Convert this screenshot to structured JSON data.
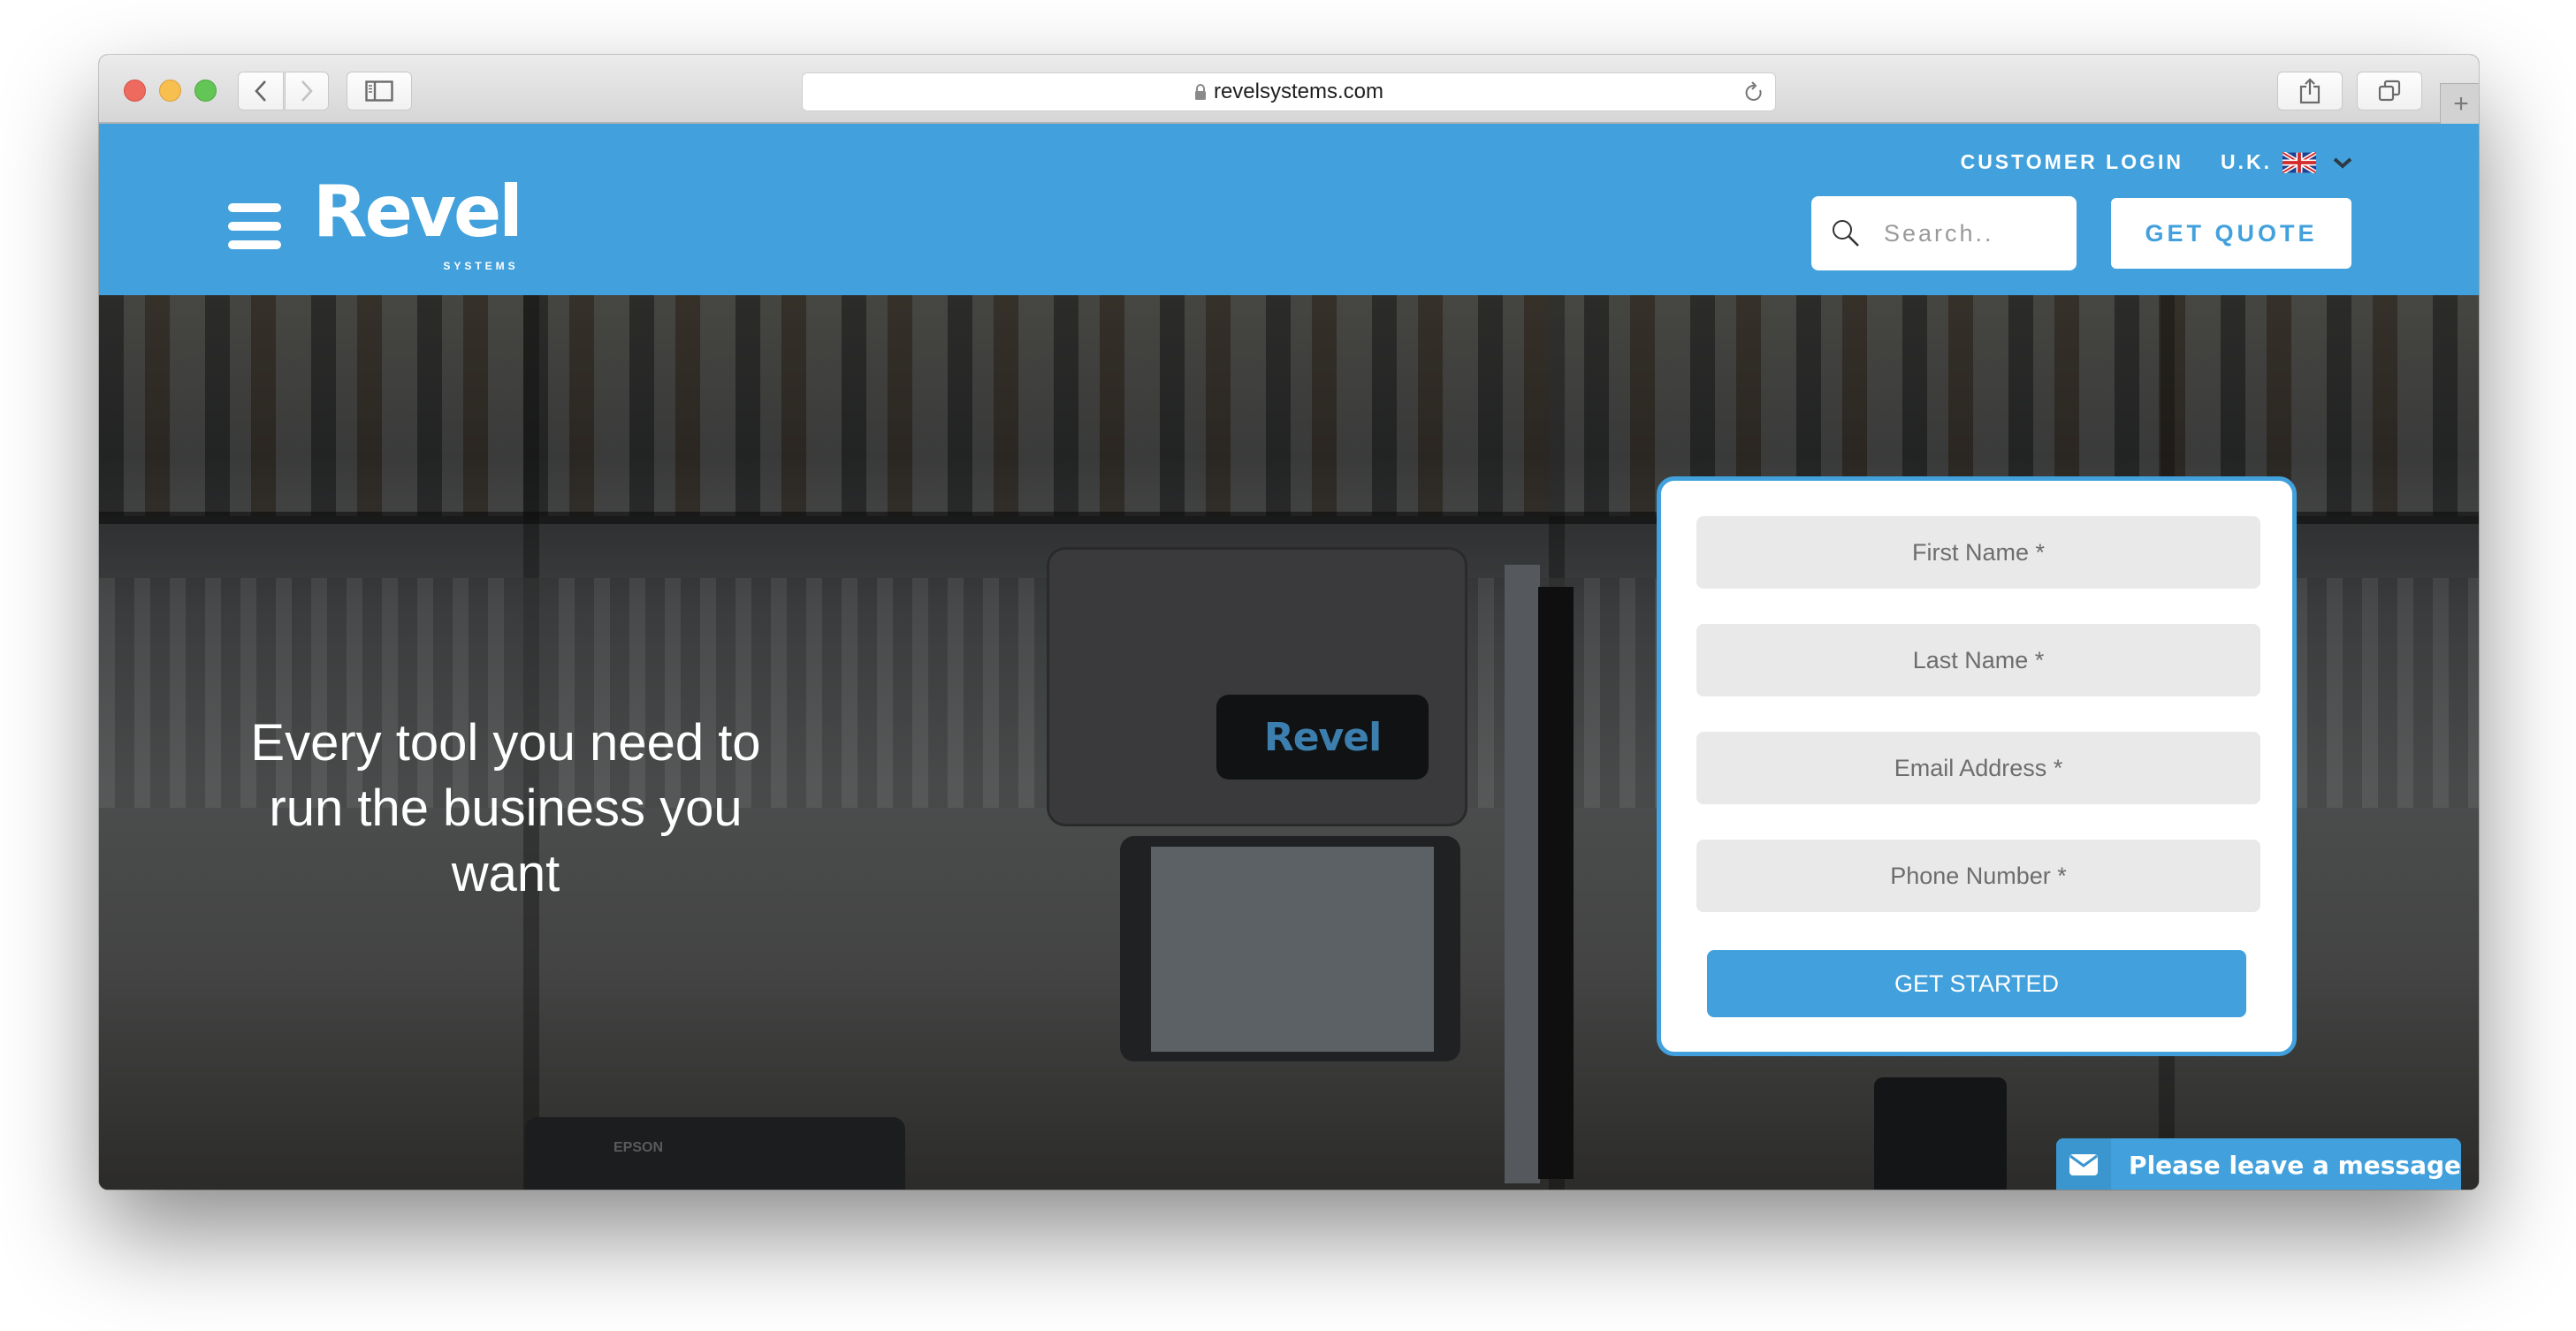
{
  "browser": {
    "url": "revelsystems.com",
    "icons": {
      "back": "chevron-left-icon",
      "forward": "chevron-right-icon",
      "sidebar": "sidebar-icon",
      "lock": "lock-icon",
      "reload": "reload-icon",
      "share": "share-icon",
      "tabs": "tabs-icon",
      "new_tab": "plus-icon"
    },
    "new_tab_glyph": "+"
  },
  "header": {
    "brand": "Revel",
    "brand_sub": "SYSTEMS",
    "customer_login": "CUSTOMER LOGIN",
    "region": "U.K.",
    "search_placeholder": "Search..",
    "get_quote": "GET QUOTE",
    "brand_color": "#42a1dc"
  },
  "hero": {
    "headline_line1": "Every tool you need to",
    "headline_line2": "run the business you want",
    "device_brand": "Revel",
    "printer_brand": "EPSON"
  },
  "form": {
    "fields": [
      {
        "name": "first-name",
        "placeholder": "First Name *",
        "value": ""
      },
      {
        "name": "last-name",
        "placeholder": "Last Name *",
        "value": ""
      },
      {
        "name": "email",
        "placeholder": "Email Address *",
        "value": ""
      },
      {
        "name": "phone",
        "placeholder": "Phone Number *",
        "value": ""
      }
    ],
    "submit_label": "GET STARTED"
  },
  "chat": {
    "label": "Please leave a message",
    "icon": "envelope-icon"
  }
}
